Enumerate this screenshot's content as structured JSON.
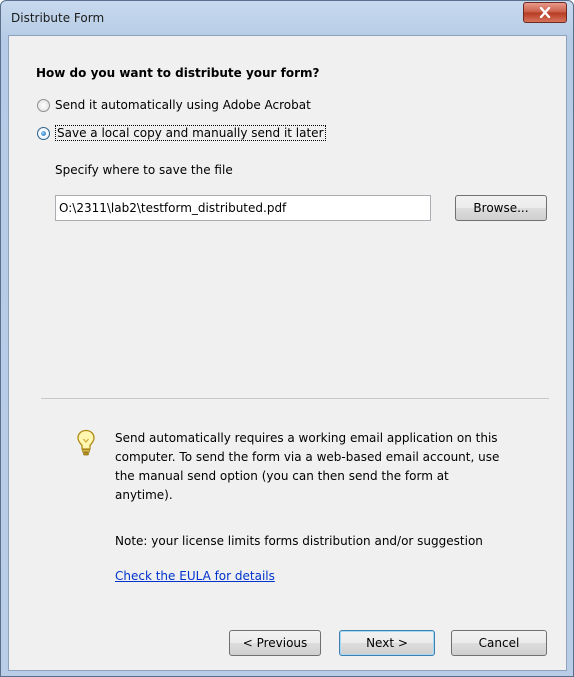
{
  "window": {
    "title": "Distribute Form",
    "close_icon": "close-x-icon"
  },
  "main": {
    "heading": "How do you want to distribute your form?",
    "options": [
      {
        "label": "Send it automatically using Adobe Acrobat",
        "selected": false
      },
      {
        "label": "Save a local copy and manually send it later",
        "selected": true
      }
    ],
    "save_location_label": "Specify where to save the file",
    "file_path": "O:\\2311\\lab2\\testform_distributed.pdf",
    "browse_label": "Browse..."
  },
  "info": {
    "icon": "lightbulb-icon",
    "message": "Send automatically requires a working email application on this computer. To send the form via a web-based email account, use the manual send option (you can then send the form at anytime).",
    "note": "Note: your license limits forms distribution and/or suggestion",
    "eula_link": "Check the EULA for details"
  },
  "footer": {
    "previous_label": "< Previous",
    "next_label": "Next >",
    "cancel_label": "Cancel"
  },
  "colors": {
    "link": "#0033cc",
    "titlebar": "#b9cde6",
    "close_button": "#c85a45",
    "selected_radio": "#1a66b0"
  }
}
